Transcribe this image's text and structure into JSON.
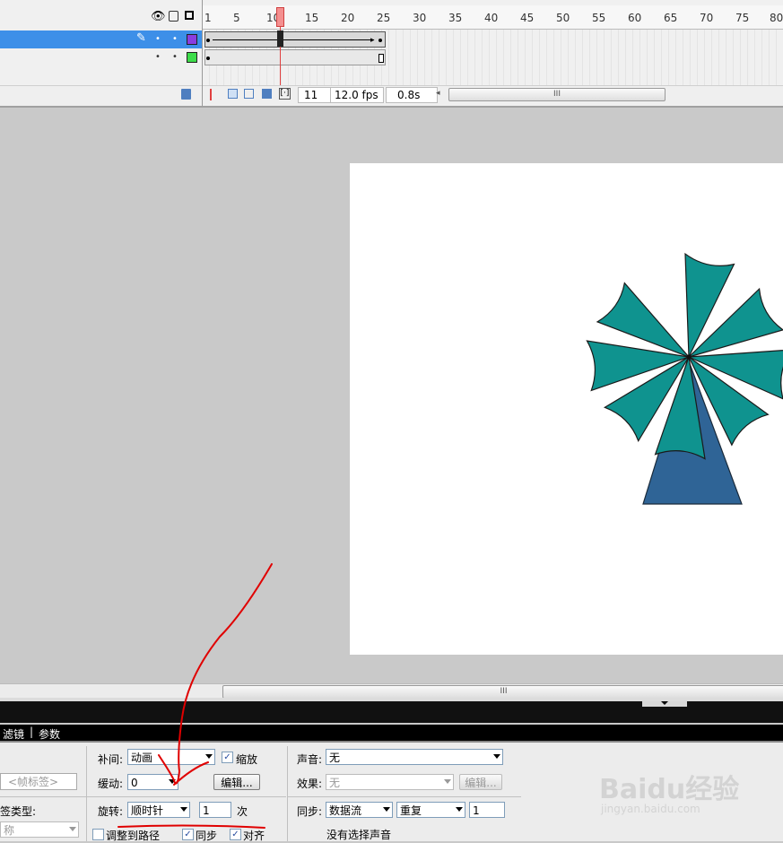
{
  "timeline": {
    "ruler_numbers": [
      "1",
      "5",
      "10",
      "15",
      "20",
      "25",
      "30",
      "35",
      "40",
      "45",
      "50",
      "55",
      "60",
      "65",
      "70",
      "75",
      "80"
    ],
    "current_frame": "11",
    "fps": "12.0 fps",
    "elapsed": "0.8s",
    "scroll_grip": "III"
  },
  "stage": {
    "scroll_grip": "III"
  },
  "panel": {
    "tabs": [
      "滤镜",
      "参数"
    ],
    "tab_separator": "|",
    "frame_label_placeholder": "<帧标签>",
    "label_type_label": "签类型:",
    "name_label": "称",
    "tween_label": "补间:",
    "tween_value": "动画",
    "scale_label": "缩放",
    "ease_label": "缓动:",
    "ease_value": "0",
    "edit_button": "编辑...",
    "rotate_label": "旋转:",
    "rotate_value": "顺时针",
    "rotate_times": "1",
    "times_unit": "次",
    "orient_to_path": "调整到路径",
    "sync_label": "同步",
    "snap_label": "对齐",
    "sound_label": "声音:",
    "sound_value": "无",
    "effect_label": "效果:",
    "effect_value": "无",
    "effect_edit_button": "编辑...",
    "sync_sound_label": "同步:",
    "sync_sound_value": "数据流",
    "repeat_value": "重复",
    "repeat_count": "1",
    "no_sound_text": "没有选择声音"
  },
  "watermark": {
    "brand": "Baidu经验",
    "url": "jingyan.baidu.com"
  },
  "colors": {
    "selected_layer": "#3d8fe8",
    "blade": "#0f938f",
    "tower": "#2f6496",
    "playhead": "#e04040",
    "annotation": "#e00000"
  }
}
